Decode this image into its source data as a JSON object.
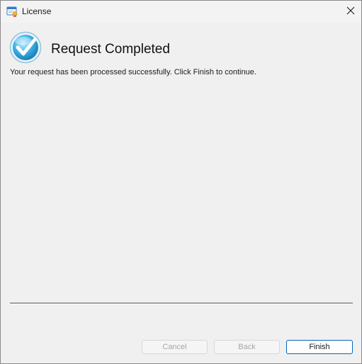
{
  "window": {
    "title": "License",
    "icon": "license-certificate-icon",
    "close_icon": "close-icon"
  },
  "page": {
    "status_icon": "checkmark-icon",
    "heading": "Request Completed",
    "message": "Your request has been processed successfully.  Click Finish to continue."
  },
  "buttons": {
    "cancel_label": "Cancel",
    "back_label": "Back",
    "finish_label": "Finish",
    "cancel_enabled": false,
    "back_enabled": false,
    "finish_enabled": true
  },
  "colors": {
    "accent": "#0067c0",
    "check_blue": "#2fa8dc",
    "disabled_text": "#a6a6a6"
  }
}
